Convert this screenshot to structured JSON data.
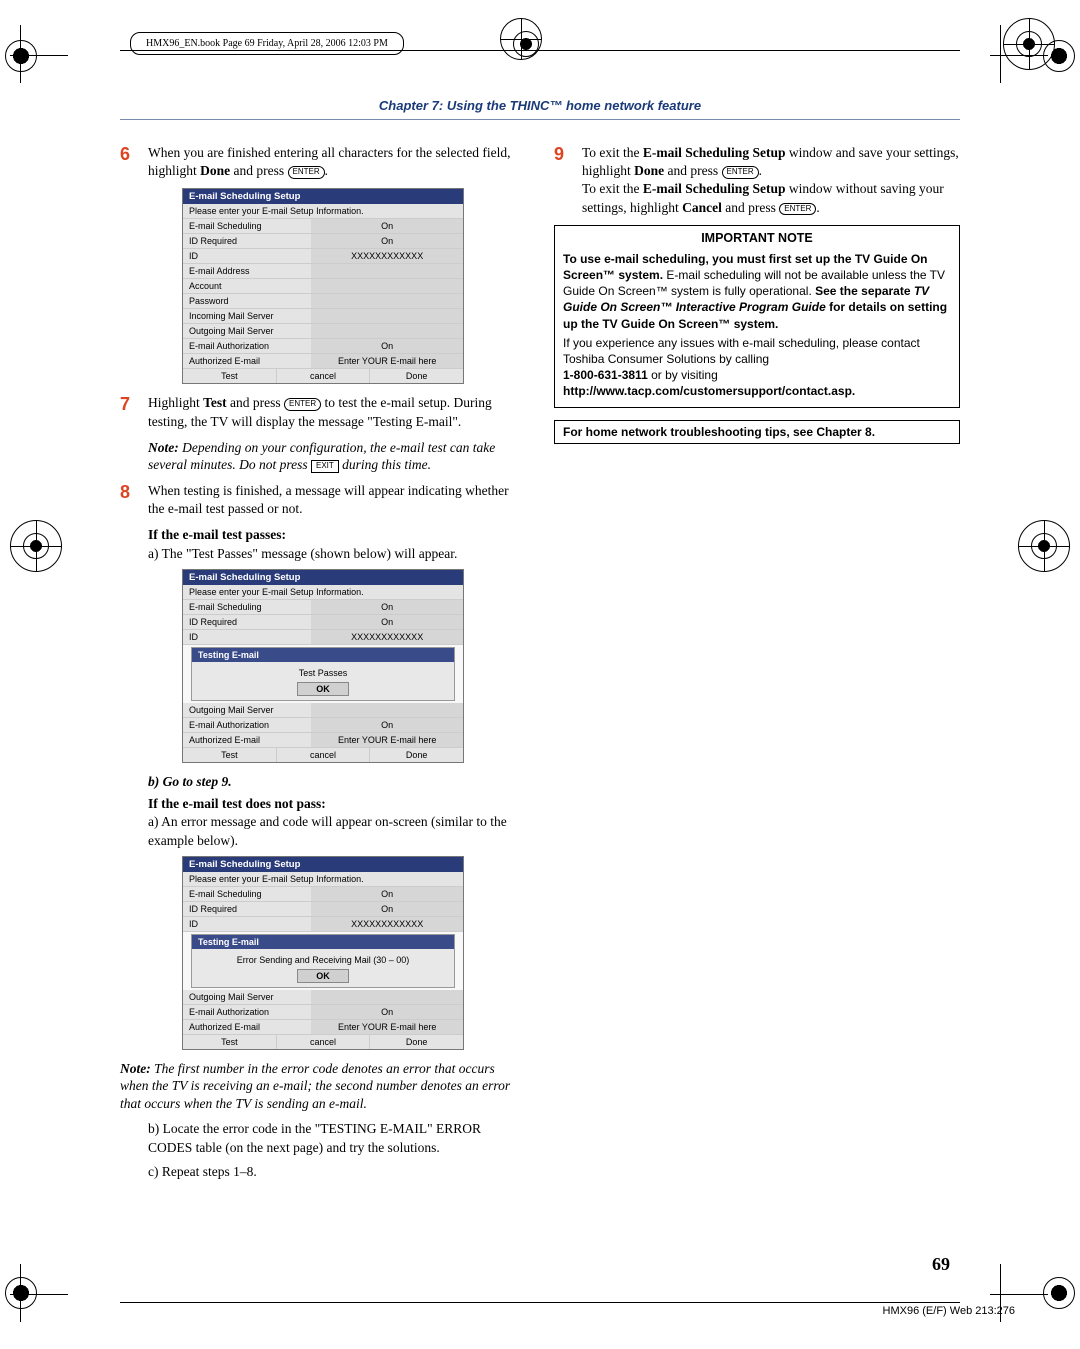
{
  "header_tag": "HMX96_EN.book  Page 69  Friday, April 28, 2006  12:03 PM",
  "chapter_header": "Chapter 7: Using the THINC™ home network feature",
  "step6": {
    "num": "6",
    "text_a": "When you are finished entering all characters for the selected field, highlight ",
    "done": "Done",
    "text_b": " and press ",
    "enter": "ENTER",
    "dot": "."
  },
  "panel1": {
    "title": "E-mail Scheduling Setup",
    "sub": "Please enter your E-mail Setup Information.",
    "rows": [
      [
        "E-mail Scheduling",
        "On"
      ],
      [
        "ID Required",
        "On"
      ],
      [
        "ID",
        "XXXXXXXXXXXX"
      ],
      [
        "E-mail Address",
        ""
      ],
      [
        "Account",
        ""
      ],
      [
        "Password",
        ""
      ],
      [
        "Incoming Mail Server",
        ""
      ],
      [
        "Outgoing Mail Server",
        ""
      ],
      [
        "E-mail Authorization",
        "On"
      ],
      [
        "Authorized E-mail",
        "Enter YOUR E-mail here"
      ]
    ],
    "buttons": [
      "Test",
      "cancel",
      "Done"
    ]
  },
  "step7": {
    "num": "7",
    "a": "Highlight ",
    "test": "Test",
    "b": " and press ",
    "enter": "ENTER",
    "c": " to test the e-mail setup. During testing, the TV will display the message \"Testing E-mail\"."
  },
  "note7": {
    "label": "Note:",
    "text_a": " Depending on your configuration, the e-mail test can take several minutes. Do not press ",
    "exit": "EXIT",
    "text_b": " during this time."
  },
  "step8": {
    "num": "8",
    "text": "When testing is finished, a message will appear indicating whether the e-mail test passed or not.",
    "pass_h": "If the e-mail test passes:",
    "pass_a": "a) The \"Test Passes\" message (shown below) will appear."
  },
  "panel2": {
    "title": "E-mail Scheduling Setup",
    "sub": "Please enter your E-mail Setup Information.",
    "top_rows": [
      [
        "E-mail Scheduling",
        "On"
      ],
      [
        "ID Required",
        "On"
      ],
      [
        "ID",
        "XXXXXXXXXXXX"
      ]
    ],
    "popup_title": "Testing E-mail",
    "popup_msg": "Test Passes",
    "ok": "OK",
    "bot_rows": [
      [
        "Outgoing Mail Server",
        ""
      ],
      [
        "E-mail Authorization",
        "On"
      ],
      [
        "Authorized E-mail",
        "Enter YOUR E-mail here"
      ]
    ],
    "buttons": [
      "Test",
      "cancel",
      "Done"
    ]
  },
  "step8b": {
    "goto": "b) Go to step 9.",
    "fail_h": "If the e-mail test does not pass:",
    "fail_a": "a) An error message and code will appear on-screen (similar to the example below)."
  },
  "panel3": {
    "title": "E-mail Scheduling Setup",
    "sub": "Please enter your E-mail Setup Information.",
    "top_rows": [
      [
        "E-mail Scheduling",
        "On"
      ],
      [
        "ID Required",
        "On"
      ],
      [
        "ID",
        "XXXXXXXXXXXX"
      ]
    ],
    "popup_title": "Testing E-mail",
    "popup_msg": "Error Sending and Receiving Mail (30 – 00)",
    "ok": "OK",
    "bot_rows": [
      [
        "Outgoing Mail Server",
        ""
      ],
      [
        "E-mail Authorization",
        "On"
      ],
      [
        "Authorized E-mail",
        "Enter YOUR E-mail here"
      ]
    ],
    "buttons": [
      "Test",
      "cancel",
      "Done"
    ]
  },
  "note3": {
    "label": "Note:",
    "text": " The first number in the error code denotes an error that occurs when the TV is receiving an e-mail; the second number denotes an error that occurs when the TV is sending an e-mail."
  },
  "step8_bc": {
    "b": "b) Locate the error code in the \"TESTING E-MAIL\" ERROR CODES table (on the next page) and try the solutions.",
    "c": "c) Repeat steps 1–8."
  },
  "step9": {
    "num": "9",
    "a": "To exit the ",
    "win": "E-mail Scheduling Setup",
    "b": " window and save your settings, highlight ",
    "done": "Done",
    "c": " and press ",
    "enter": "ENTER",
    "dot": ".",
    "d": "To exit the ",
    "e": " window without saving your settings, highlight ",
    "cancel": "Cancel",
    "f": " and press "
  },
  "important": {
    "title": "IMPORTANT NOTE",
    "body1a": "To use e-mail scheduling, you must first set up the TV Guide On Screen™ system.",
    "body1b": " E-mail scheduling will not be available unless the TV Guide On Screen™ system is fully operational. ",
    "body1c": "See the separate ",
    "body1d": "TV Guide On Screen™ Interactive Program Guide",
    "body1e": " for details on setting up the TV Guide On Screen™ system.",
    "body2": "If you experience any issues with e-mail scheduling, please contact Toshiba Consumer Solutions by calling",
    "phone": "1-800-631-3811",
    "body3": " or by visiting",
    "url": "http://www.tacp.com/customersupport/contact.asp."
  },
  "homebox": "For home network troubleshooting tips, see Chapter 8.",
  "page_num": "69",
  "foot_code": "HMX96 (E/F) Web 213:276"
}
